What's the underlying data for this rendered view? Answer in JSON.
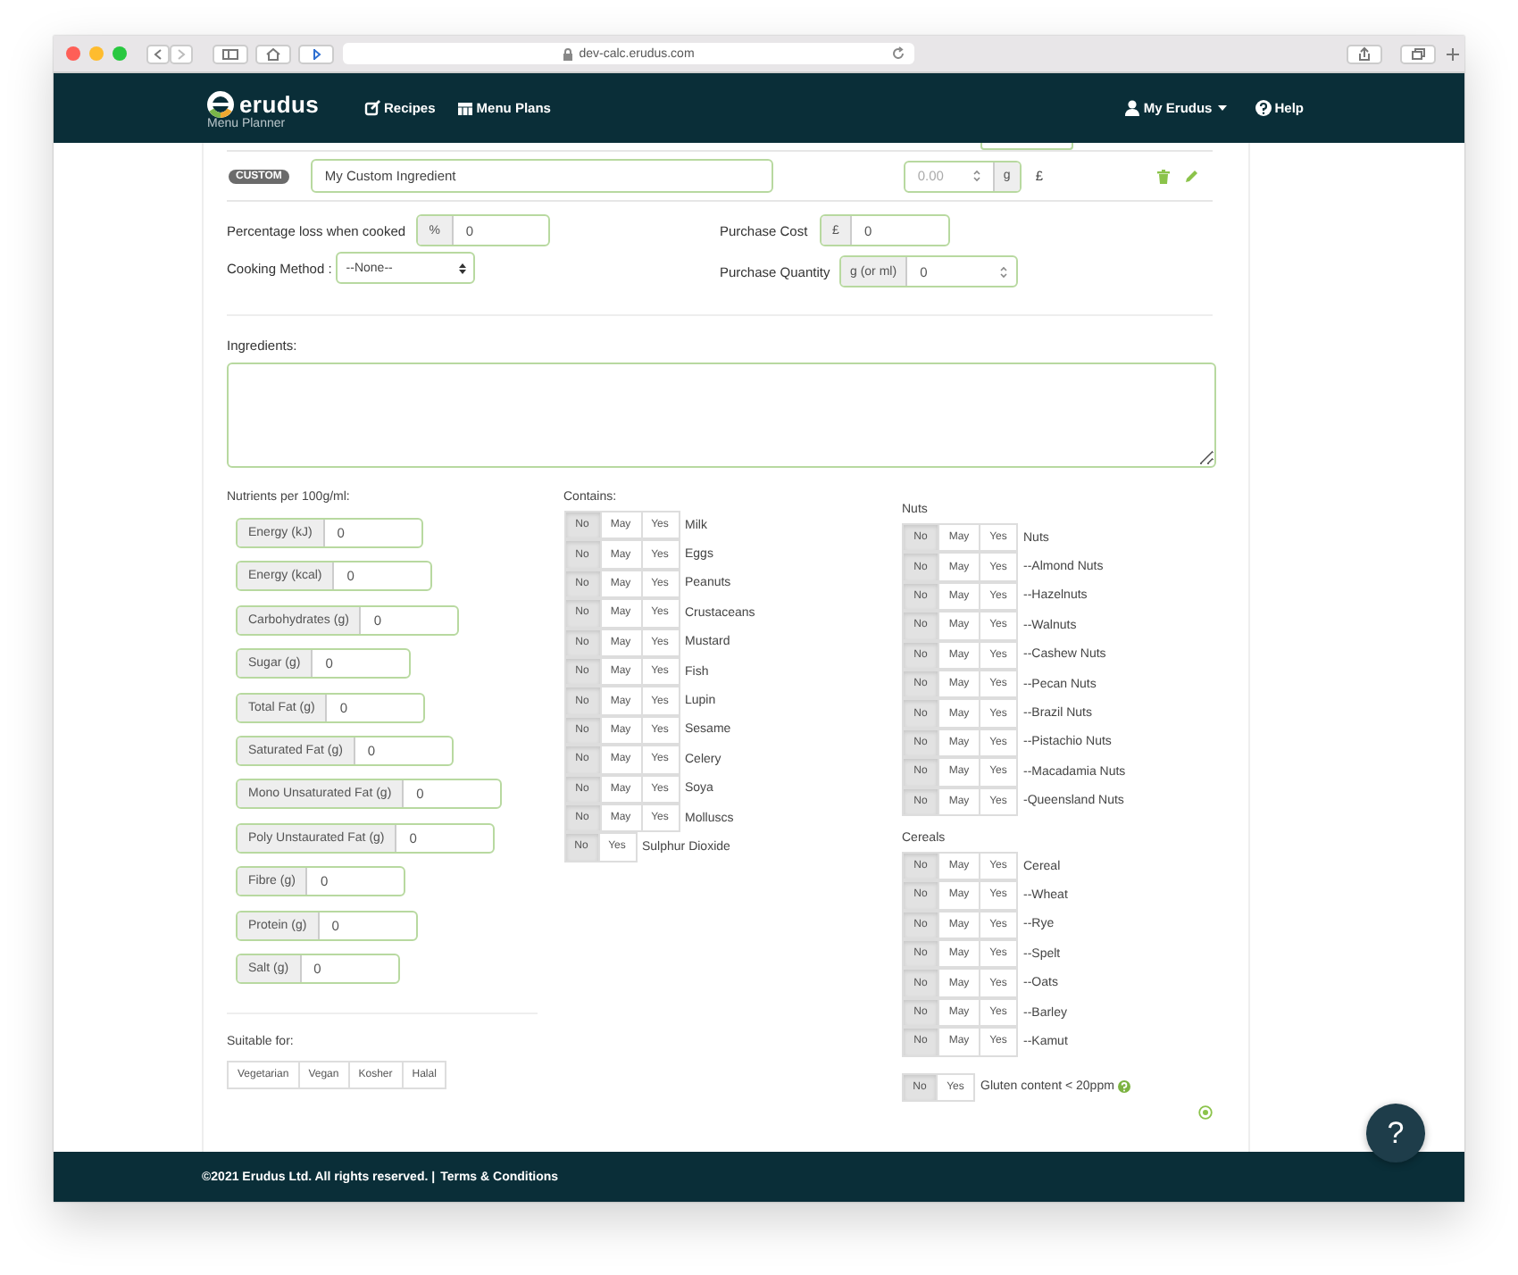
{
  "browser": {
    "url": "dev-calc.erudus.com"
  },
  "nav": {
    "brand": "erudus",
    "subtitle": "Menu Planner",
    "links": [
      {
        "label": "Recipes"
      },
      {
        "label": "Menu Plans"
      }
    ],
    "account": "My Erudus",
    "help": "Help"
  },
  "ingredient": {
    "badge": "CUSTOM",
    "name": "My Custom Ingredient",
    "quantity": {
      "placeholder": "0.00",
      "unit": "g"
    },
    "currency": "£"
  },
  "percentage_loss": {
    "label": "Percentage loss when cooked",
    "addon": "%",
    "value": "0"
  },
  "cooking_method": {
    "label": "Cooking Method :",
    "value": "--None--"
  },
  "purchase_cost": {
    "label": "Purchase Cost",
    "addon": "£",
    "value": "0"
  },
  "purchase_quantity": {
    "label": "Purchase Quantity",
    "addon": "g (or ml)",
    "value": "0"
  },
  "ingredients": {
    "label": "Ingredients:"
  },
  "nutrients": {
    "title": "Nutrients per 100g/ml:",
    "items": [
      {
        "label": "Energy (kJ)",
        "value": "0"
      },
      {
        "label": "Energy (kcal)",
        "value": "0"
      },
      {
        "label": "Carbohydrates (g)",
        "value": "0"
      },
      {
        "label": "Sugar (g)",
        "value": "0"
      },
      {
        "label": "Total Fat (g)",
        "value": "0"
      },
      {
        "label": "Saturated Fat (g)",
        "value": "0"
      },
      {
        "label": "Mono Unsaturated Fat (g)",
        "value": "0"
      },
      {
        "label": "Poly Unstaurated Fat (g)",
        "value": "0"
      },
      {
        "label": "Fibre (g)",
        "value": "0"
      },
      {
        "label": "Protein (g)",
        "value": "0"
      },
      {
        "label": "Salt (g)",
        "value": "0"
      }
    ]
  },
  "suitable": {
    "title": "Suitable for:",
    "options": [
      {
        "label": "Vegetarian",
        "selected": false
      },
      {
        "label": "Vegan",
        "selected": false
      },
      {
        "label": "Kosher",
        "selected": false
      },
      {
        "label": "Halal",
        "selected": false
      }
    ]
  },
  "contains": {
    "title": "Contains:",
    "items": [
      {
        "label": "Milk",
        "options": [
          {
            "label": "No",
            "selected": true
          },
          {
            "label": "May",
            "selected": false
          },
          {
            "label": "Yes",
            "selected": false
          }
        ]
      },
      {
        "label": "Eggs",
        "options": [
          {
            "label": "No",
            "selected": true
          },
          {
            "label": "May",
            "selected": false
          },
          {
            "label": "Yes",
            "selected": false
          }
        ]
      },
      {
        "label": "Peanuts",
        "options": [
          {
            "label": "No",
            "selected": true
          },
          {
            "label": "May",
            "selected": false
          },
          {
            "label": "Yes",
            "selected": false
          }
        ]
      },
      {
        "label": "Crustaceans",
        "options": [
          {
            "label": "No",
            "selected": true
          },
          {
            "label": "May",
            "selected": false
          },
          {
            "label": "Yes",
            "selected": false
          }
        ]
      },
      {
        "label": "Mustard",
        "options": [
          {
            "label": "No",
            "selected": true
          },
          {
            "label": "May",
            "selected": false
          },
          {
            "label": "Yes",
            "selected": false
          }
        ]
      },
      {
        "label": "Fish",
        "options": [
          {
            "label": "No",
            "selected": true
          },
          {
            "label": "May",
            "selected": false
          },
          {
            "label": "Yes",
            "selected": false
          }
        ]
      },
      {
        "label": "Lupin",
        "options": [
          {
            "label": "No",
            "selected": true
          },
          {
            "label": "May",
            "selected": false
          },
          {
            "label": "Yes",
            "selected": false
          }
        ]
      },
      {
        "label": "Sesame",
        "options": [
          {
            "label": "No",
            "selected": true
          },
          {
            "label": "May",
            "selected": false
          },
          {
            "label": "Yes",
            "selected": false
          }
        ]
      },
      {
        "label": "Celery",
        "options": [
          {
            "label": "No",
            "selected": true
          },
          {
            "label": "May",
            "selected": false
          },
          {
            "label": "Yes",
            "selected": false
          }
        ]
      },
      {
        "label": "Soya",
        "options": [
          {
            "label": "No",
            "selected": true
          },
          {
            "label": "May",
            "selected": false
          },
          {
            "label": "Yes",
            "selected": false
          }
        ]
      },
      {
        "label": "Molluscs",
        "options": [
          {
            "label": "No",
            "selected": true
          },
          {
            "label": "May",
            "selected": false
          },
          {
            "label": "Yes",
            "selected": false
          }
        ]
      },
      {
        "label": "Sulphur Dioxide",
        "options": [
          {
            "label": "No",
            "selected": true
          },
          {
            "label": "Yes",
            "selected": false
          }
        ]
      }
    ]
  },
  "nuts": {
    "title": "Nuts",
    "items": [
      {
        "label": "Nuts",
        "options": [
          {
            "label": "No",
            "selected": true
          },
          {
            "label": "May",
            "selected": false
          },
          {
            "label": "Yes",
            "selected": false
          }
        ]
      },
      {
        "label": "--Almond Nuts",
        "options": [
          {
            "label": "No",
            "selected": true
          },
          {
            "label": "May",
            "selected": false
          },
          {
            "label": "Yes",
            "selected": false
          }
        ]
      },
      {
        "label": "--Hazelnuts",
        "options": [
          {
            "label": "No",
            "selected": true
          },
          {
            "label": "May",
            "selected": false
          },
          {
            "label": "Yes",
            "selected": false
          }
        ]
      },
      {
        "label": "--Walnuts",
        "options": [
          {
            "label": "No",
            "selected": true
          },
          {
            "label": "May",
            "selected": false
          },
          {
            "label": "Yes",
            "selected": false
          }
        ]
      },
      {
        "label": "--Cashew Nuts",
        "options": [
          {
            "label": "No",
            "selected": true
          },
          {
            "label": "May",
            "selected": false
          },
          {
            "label": "Yes",
            "selected": false
          }
        ]
      },
      {
        "label": "--Pecan Nuts",
        "options": [
          {
            "label": "No",
            "selected": true
          },
          {
            "label": "May",
            "selected": false
          },
          {
            "label": "Yes",
            "selected": false
          }
        ]
      },
      {
        "label": "--Brazil Nuts",
        "options": [
          {
            "label": "No",
            "selected": true
          },
          {
            "label": "May",
            "selected": false
          },
          {
            "label": "Yes",
            "selected": false
          }
        ]
      },
      {
        "label": "--Pistachio Nuts",
        "options": [
          {
            "label": "No",
            "selected": true
          },
          {
            "label": "May",
            "selected": false
          },
          {
            "label": "Yes",
            "selected": false
          }
        ]
      },
      {
        "label": "--Macadamia Nuts",
        "options": [
          {
            "label": "No",
            "selected": true
          },
          {
            "label": "May",
            "selected": false
          },
          {
            "label": "Yes",
            "selected": false
          }
        ]
      },
      {
        "label": "-Queensland Nuts",
        "options": [
          {
            "label": "No",
            "selected": true
          },
          {
            "label": "May",
            "selected": false
          },
          {
            "label": "Yes",
            "selected": false
          }
        ]
      }
    ]
  },
  "cereals": {
    "title": "Cereals",
    "items": [
      {
        "label": "Cereal",
        "options": [
          {
            "label": "No",
            "selected": true
          },
          {
            "label": "May",
            "selected": false
          },
          {
            "label": "Yes",
            "selected": false
          }
        ]
      },
      {
        "label": "--Wheat",
        "options": [
          {
            "label": "No",
            "selected": true
          },
          {
            "label": "May",
            "selected": false
          },
          {
            "label": "Yes",
            "selected": false
          }
        ]
      },
      {
        "label": "--Rye",
        "options": [
          {
            "label": "No",
            "selected": true
          },
          {
            "label": "May",
            "selected": false
          },
          {
            "label": "Yes",
            "selected": false
          }
        ]
      },
      {
        "label": "--Spelt",
        "options": [
          {
            "label": "No",
            "selected": true
          },
          {
            "label": "May",
            "selected": false
          },
          {
            "label": "Yes",
            "selected": false
          }
        ]
      },
      {
        "label": "--Oats",
        "options": [
          {
            "label": "No",
            "selected": true
          },
          {
            "label": "May",
            "selected": false
          },
          {
            "label": "Yes",
            "selected": false
          }
        ]
      },
      {
        "label": "--Barley",
        "options": [
          {
            "label": "No",
            "selected": true
          },
          {
            "label": "May",
            "selected": false
          },
          {
            "label": "Yes",
            "selected": false
          }
        ]
      },
      {
        "label": "--Kamut",
        "options": [
          {
            "label": "No",
            "selected": true
          },
          {
            "label": "May",
            "selected": false
          },
          {
            "label": "Yes",
            "selected": false
          }
        ]
      }
    ]
  },
  "gluten": {
    "label": "Gluten content < 20ppm",
    "options": [
      {
        "label": "No",
        "selected": true
      },
      {
        "label": "Yes",
        "selected": false
      }
    ]
  },
  "footer": {
    "text": "©2021 Erudus Ltd. All rights reserved. |",
    "link": "Terms & Conditions"
  },
  "help_bubble": "?"
}
